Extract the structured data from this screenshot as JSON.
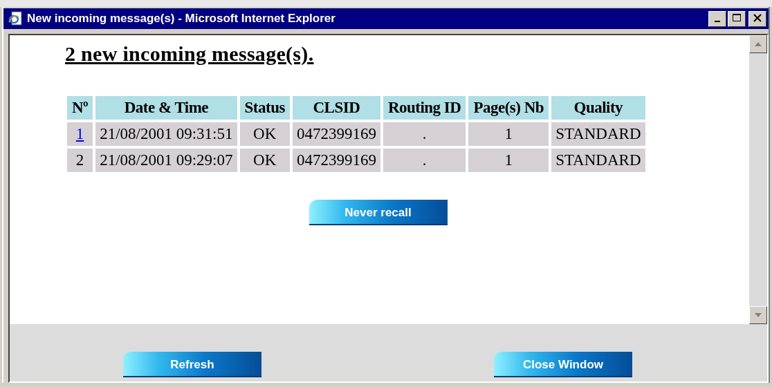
{
  "window": {
    "title": "New incoming message(s) - Microsoft Internet Explorer"
  },
  "heading": "2 new incoming message(s).",
  "table": {
    "columns": [
      "Nº",
      "Date & Time",
      "Status",
      "CLSID",
      "Routing ID",
      "Page(s) Nb",
      "Quality"
    ],
    "rows": [
      {
        "link": true,
        "cells": [
          "1",
          "21/08/2001 09:31:51",
          "OK",
          "0472399169",
          ".",
          "1",
          "STANDARD"
        ]
      },
      {
        "link": false,
        "cells": [
          "2",
          "21/08/2001 09:29:07",
          "OK",
          "0472399169",
          ".",
          "1",
          "STANDARD"
        ]
      }
    ]
  },
  "content_buttons": [
    "Never recall"
  ],
  "footer_buttons": [
    "Refresh",
    "Close Window"
  ]
}
